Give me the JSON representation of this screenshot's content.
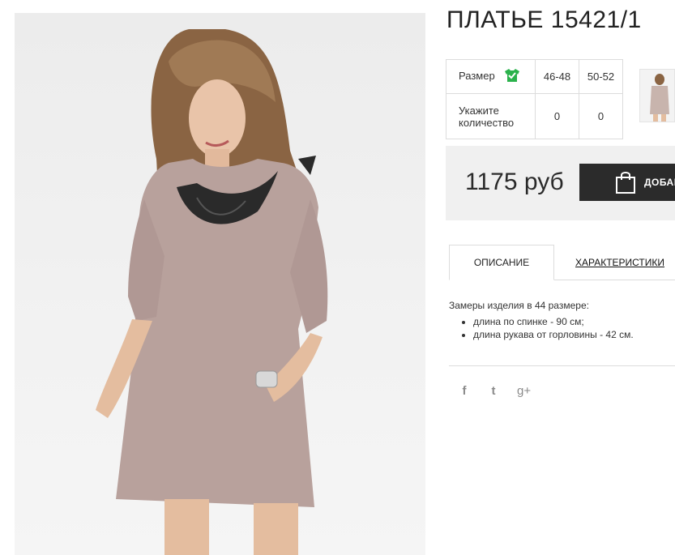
{
  "product": {
    "title": "ПЛАТЬЕ 15421/1"
  },
  "sizes": {
    "size_label": "Размер",
    "qty_label": "Укажите количество",
    "columns": [
      "46-48",
      "50-52"
    ],
    "quantities": [
      "0",
      "0"
    ]
  },
  "price": {
    "value": "1175 руб",
    "cart_label": "ДОБАВИТЬ"
  },
  "tabs": {
    "description": "ОПИСАНИЕ",
    "characteristics": "ХАРАКТЕРИСТИКИ"
  },
  "description": {
    "intro": "Замеры изделия в 44 размере:",
    "items": [
      "длина по спинке - 90 см;",
      "длина рукава от горловины - 42 см."
    ]
  },
  "social": {
    "facebook": "f",
    "twitter": "t",
    "googleplus": "g+"
  },
  "colors": {
    "dress": "#b8a19c",
    "lace": "#2a2a2a",
    "check_green": "#2bb24c",
    "button_dark": "#2b2b2b",
    "price_bg": "#f0f0f0"
  },
  "icons": [
    "check-shirt-icon",
    "shopping-bag-icon",
    "facebook-icon",
    "twitter-icon",
    "google-plus-icon"
  ]
}
